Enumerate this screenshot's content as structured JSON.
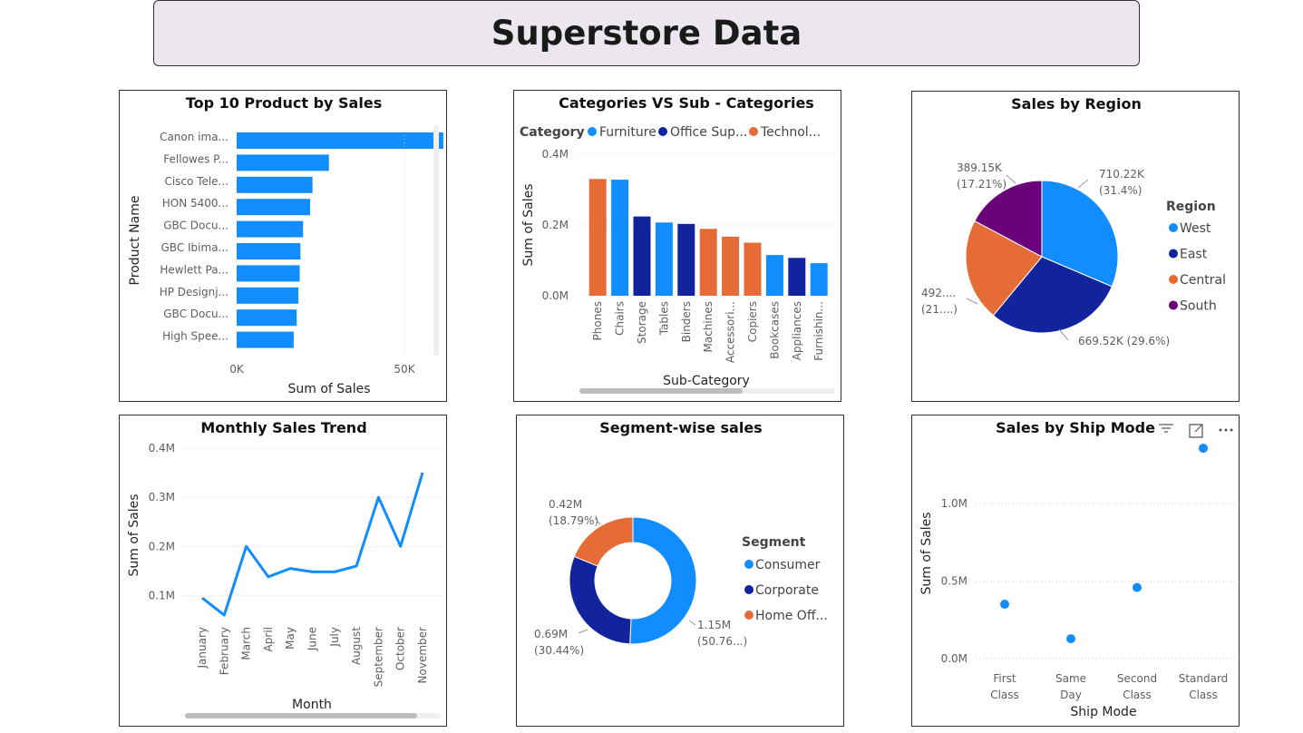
{
  "page_title": "Superstore Data",
  "icons": {
    "filter": "filter-icon",
    "focus": "focus-mode-icon",
    "more": "more-options-icon"
  },
  "colors": {
    "blue": "#118DFF",
    "navy": "#12239E",
    "orange": "#E66C37",
    "purple": "#6B007B"
  },
  "chart_data": [
    {
      "id": "top_products",
      "type": "bar",
      "orientation": "horizontal",
      "title": "Top 10 Product by Sales",
      "xlabel": "Sum of Sales",
      "ylabel": "Product Name",
      "xticks": [
        "0K",
        "50K"
      ],
      "xlim": [
        0,
        70000
      ],
      "categories": [
        "Canon ima...",
        "Fellowes P...",
        "Cisco Tele...",
        "HON 5400...",
        "GBC Docu...",
        "GBC Ibima...",
        "Hewlett Pa...",
        "HP Designj...",
        "GBC Docu...",
        "High Spee..."
      ],
      "values": [
        61600,
        27500,
        22600,
        21900,
        19800,
        19000,
        18800,
        18400,
        17900,
        17000
      ]
    },
    {
      "id": "categories",
      "type": "bar",
      "title": "Categories VS Sub - Categories",
      "xlabel": "Sub-Category",
      "ylabel": "Sum of Sales",
      "legend_title": "Category",
      "legend": [
        {
          "name": "Furniture",
          "color": "#118DFF"
        },
        {
          "name": "Office Sup...",
          "color": "#12239E"
        },
        {
          "name": "Technol...",
          "color": "#E66C37"
        }
      ],
      "yticks": [
        "0.0M",
        "0.2M",
        "0.4M"
      ],
      "ylim": [
        0,
        0.4
      ],
      "categories": [
        "Phones",
        "Chairs",
        "Storage",
        "Tables",
        "Binders",
        "Machines",
        "Accessori...",
        "Copiers",
        "Bookcases",
        "Appliances",
        "Furnishin..."
      ],
      "values": [
        0.33,
        0.328,
        0.224,
        0.207,
        0.203,
        0.189,
        0.167,
        0.15,
        0.115,
        0.107,
        0.092
      ],
      "series_index": [
        2,
        0,
        1,
        0,
        1,
        2,
        2,
        2,
        0,
        1,
        0
      ]
    },
    {
      "id": "region",
      "type": "pie",
      "title": "Sales by Region",
      "legend_title": "Region",
      "labels": [
        "West",
        "East",
        "Central",
        "South"
      ],
      "values": [
        31.4,
        29.6,
        21.79,
        17.21
      ],
      "colors": [
        "#118DFF",
        "#12239E",
        "#E66C37",
        "#6B007B"
      ],
      "data_labels": [
        [
          "710.22K",
          "(31.4%)"
        ],
        [
          "669.52K (29.6%)"
        ],
        [
          "492....",
          "(21....)"
        ],
        [
          "389.15K",
          "(17.21%)"
        ]
      ]
    },
    {
      "id": "monthly",
      "type": "line",
      "title": "Monthly Sales Trend",
      "xlabel": "Month",
      "ylabel": "Sum of Sales",
      "yticks": [
        "0.1M",
        "0.2M",
        "0.3M",
        "0.4M"
      ],
      "ylim": [
        0.025,
        0.4
      ],
      "categories": [
        "January",
        "February",
        "March",
        "April",
        "May",
        "June",
        "July",
        "August",
        "September",
        "October",
        "November"
      ],
      "values": [
        0.095,
        0.06,
        0.2,
        0.138,
        0.155,
        0.148,
        0.148,
        0.16,
        0.3,
        0.2,
        0.35
      ]
    },
    {
      "id": "segment",
      "type": "pie",
      "donut": true,
      "title": "Segment-wise sales",
      "legend_title": "Segment",
      "labels": [
        "Consumer",
        "Corporate",
        "Home Off..."
      ],
      "values": [
        50.76,
        30.44,
        18.79
      ],
      "colors": [
        "#118DFF",
        "#12239E",
        "#E66C37"
      ],
      "data_labels": [
        [
          "1.15M",
          "(50.76...)"
        ],
        [
          "0.69M",
          "(30.44%)"
        ],
        [
          "0.42M",
          "(18.79%)"
        ]
      ]
    },
    {
      "id": "shipmode",
      "type": "scatter",
      "title": "Sales by Ship Mode",
      "xlabel": "Ship Mode",
      "ylabel": "Sum of Sales",
      "yticks": [
        "0.0M",
        "0.5M",
        "1.0M"
      ],
      "ylim": [
        0,
        1.3
      ],
      "categories": [
        [
          "First",
          "Class"
        ],
        [
          "Same",
          "Day"
        ],
        [
          "Second",
          "Class"
        ],
        [
          "Standard",
          "Class"
        ]
      ],
      "values": [
        0.351,
        0.128,
        0.459,
        1.358
      ]
    }
  ]
}
